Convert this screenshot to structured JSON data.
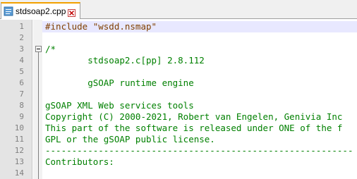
{
  "tab": {
    "filename": "stdsoap2.cpp",
    "icon": "file-icon",
    "close_icon": "close-icon"
  },
  "colors": {
    "preprocessor": "#804000",
    "comment": "#008000",
    "line_number": "#808080",
    "gutter_bg": "#e4e4e4",
    "current_line_bg": "#e8e8ff",
    "tab_accent": "#f2a000"
  },
  "editor": {
    "current_line": 1,
    "lines": [
      {
        "num": "1",
        "text": "#include \"wsdd.nsmap\"",
        "style": "preproc"
      },
      {
        "num": "2",
        "text": "",
        "style": "comment"
      },
      {
        "num": "3",
        "text": "/*",
        "style": "comment",
        "fold": true
      },
      {
        "num": "4",
        "text": "        stdsoap2.c[pp] 2.8.112",
        "style": "comment"
      },
      {
        "num": "5",
        "text": "",
        "style": "comment"
      },
      {
        "num": "6",
        "text": "        gSOAP runtime engine",
        "style": "comment"
      },
      {
        "num": "7",
        "text": "",
        "style": "comment"
      },
      {
        "num": "8",
        "text": "gSOAP XML Web services tools",
        "style": "comment"
      },
      {
        "num": "9",
        "text": "Copyright (C) 2000-2021, Robert van Engelen, Genivia Inc",
        "style": "comment"
      },
      {
        "num": "10",
        "text": "This part of the software is released under ONE of the f",
        "style": "comment"
      },
      {
        "num": "11",
        "text": "GPL or the gSOAP public license.",
        "style": "comment"
      },
      {
        "num": "12",
        "text": "----------------------------------------------------------",
        "style": "comment"
      },
      {
        "num": "13",
        "text": "Contributors:",
        "style": "comment"
      },
      {
        "num": "14",
        "text": "",
        "style": "comment"
      }
    ]
  }
}
